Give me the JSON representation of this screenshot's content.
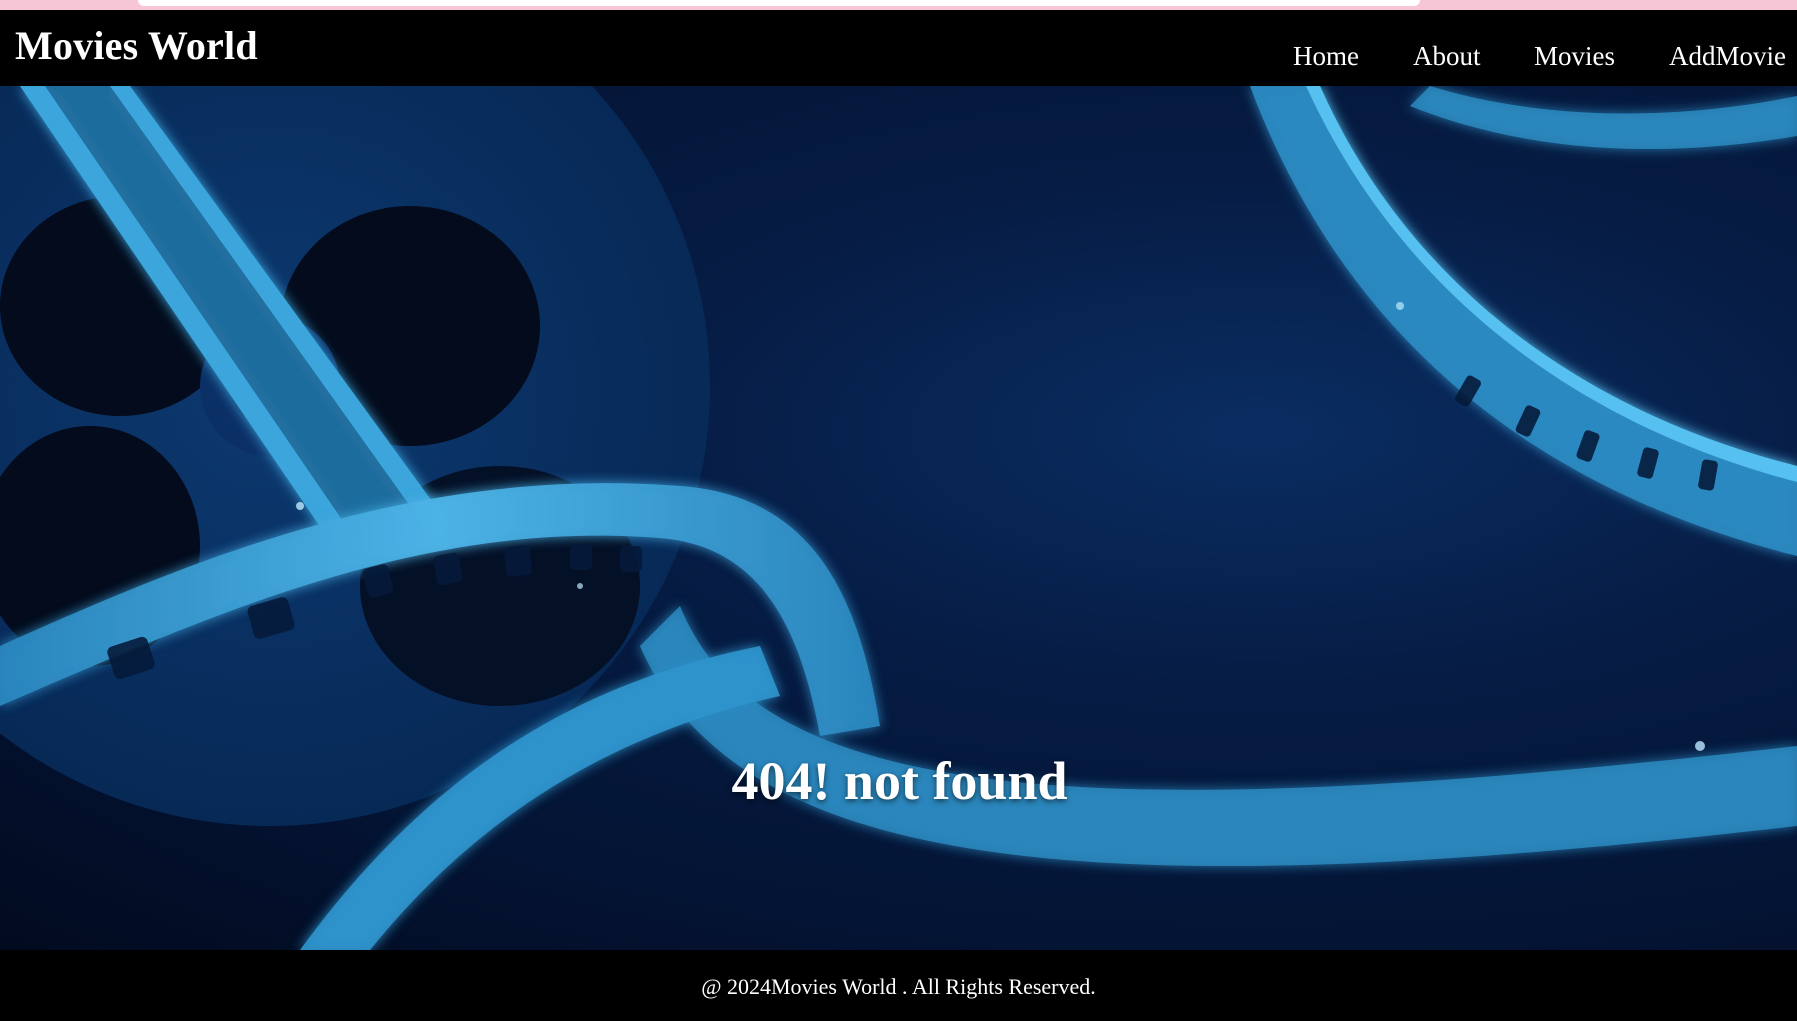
{
  "brand": {
    "title": "Movies World"
  },
  "nav": {
    "items": [
      {
        "label": "Home"
      },
      {
        "label": "About"
      },
      {
        "label": "Movies"
      },
      {
        "label": "AddMovie"
      }
    ]
  },
  "hero": {
    "background_icon": "film-reel-background",
    "error_message": "404! not found"
  },
  "footer": {
    "copyright": "@ 2024Movies World . All Rights Reserved."
  },
  "colors": {
    "navbar_bg": "#000000",
    "footer_bg": "#000000",
    "text": "#ffffff",
    "hero_dark": "#041434",
    "film_blue": "#3a9fd6",
    "top_strip": "#f7c6d6"
  }
}
